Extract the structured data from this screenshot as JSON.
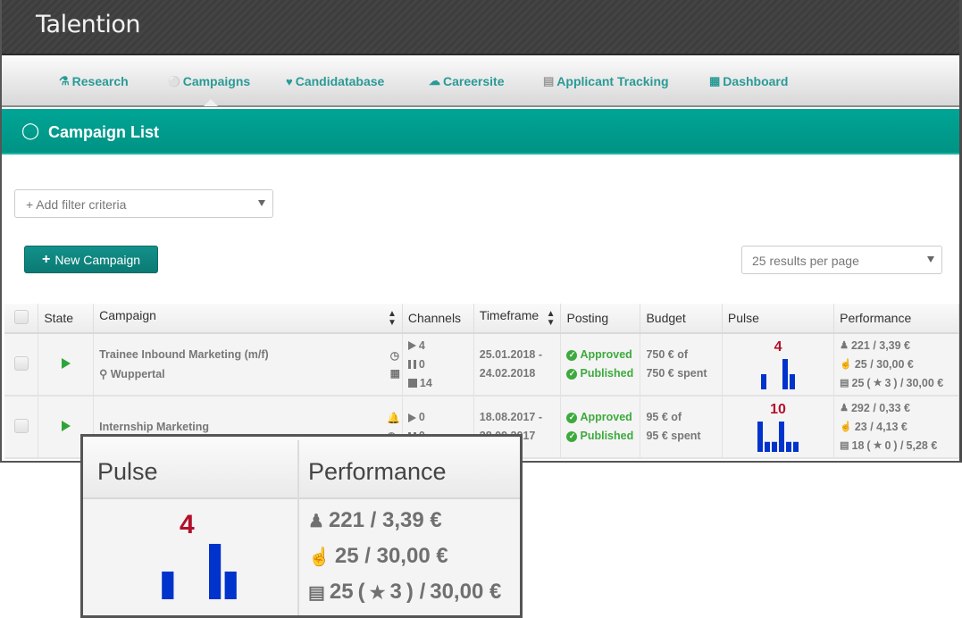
{
  "app": {
    "logo": "Talention"
  },
  "nav": {
    "items": [
      {
        "label": "Research",
        "icon": "flask-icon",
        "glyph": "⚗"
      },
      {
        "label": "Campaigns",
        "icon": "lightbulb-icon",
        "glyph": "💡"
      },
      {
        "label": "Candidatabase",
        "icon": "heart-icon",
        "glyph": "♥"
      },
      {
        "label": "Careersite",
        "icon": "cloud-icon",
        "glyph": "☁"
      },
      {
        "label": "Applicant Tracking",
        "icon": "document-icon",
        "glyph": "🗎"
      },
      {
        "label": "Dashboard",
        "icon": "grid-icon",
        "glyph": "▦"
      }
    ],
    "active": "Campaigns"
  },
  "page": {
    "title": "Campaign List",
    "title_icon": "lightbulb-icon"
  },
  "filters": {
    "placeholder": "+ Add filter criteria"
  },
  "toolbar": {
    "new_campaign": "New Campaign",
    "per_page": "25 results per page"
  },
  "table": {
    "headers": [
      "",
      "State",
      "Campaign",
      "Channels",
      "Timeframe",
      "Posting",
      "Budget",
      "Pulse",
      "Performance"
    ],
    "rows": [
      {
        "state": "running",
        "name": "Trainee Inbound Marketing (m/f)",
        "location": "Wuppertal",
        "side_icons": [
          "clock-icon",
          "calendar-icon"
        ],
        "channels": {
          "running": "4",
          "paused": "0",
          "stopped": "14"
        },
        "timeframe_start": "25.01.2018 -",
        "timeframe_end": "24.02.2018",
        "posting": [
          "Approved",
          "Published"
        ],
        "budget_line1": "750 € of",
        "budget_line2": "750 € spent",
        "pulse": {
          "value": "4",
          "bars": [
            0.5,
            0,
            0,
            1,
            0.5
          ]
        },
        "performance": {
          "visitors": "221 / 3,39 €",
          "clicks": "25 / 30,00 €",
          "applications": "25 (★ 3) / 30,00 €",
          "app_count": "25",
          "stars": "3",
          "app_cost": "30,00 €"
        }
      },
      {
        "state": "running",
        "name": "Internship Marketing",
        "location": "",
        "side_icons": [
          "bell-icon",
          "clock-icon"
        ],
        "channels": {
          "running": "0",
          "paused": "0"
        },
        "timeframe_start": "18.08.2017 -",
        "timeframe_end": "28.09.2017",
        "posting": [
          "Approved",
          "Published"
        ],
        "budget_line1": "95 € of",
        "budget_line2": "95 € spent",
        "pulse": {
          "value": "10",
          "bars": [
            1,
            0.33,
            0.33,
            1,
            0.33,
            0.33
          ]
        },
        "performance": {
          "visitors": "292 / 0,33 €",
          "clicks": "23 / 4,13 €",
          "app_count": "18",
          "stars": "0",
          "app_cost": "5,28 €"
        }
      }
    ]
  },
  "zoom_inset": {
    "pulse_header": "Pulse",
    "performance_header": "Performance",
    "pulse_value": "4",
    "bars": [
      0.5,
      0,
      0,
      1,
      0.5
    ],
    "visitors": "221 / 3,39 €",
    "clicks": "25 / 30,00 €",
    "app_count": "25",
    "stars": "3",
    "app_cost": "30,00 €"
  },
  "colors": {
    "brand": "#009a8c",
    "pulse_bar": "#0033cc",
    "pulse_value": "#b3102a",
    "ok": "#3daa3d"
  }
}
